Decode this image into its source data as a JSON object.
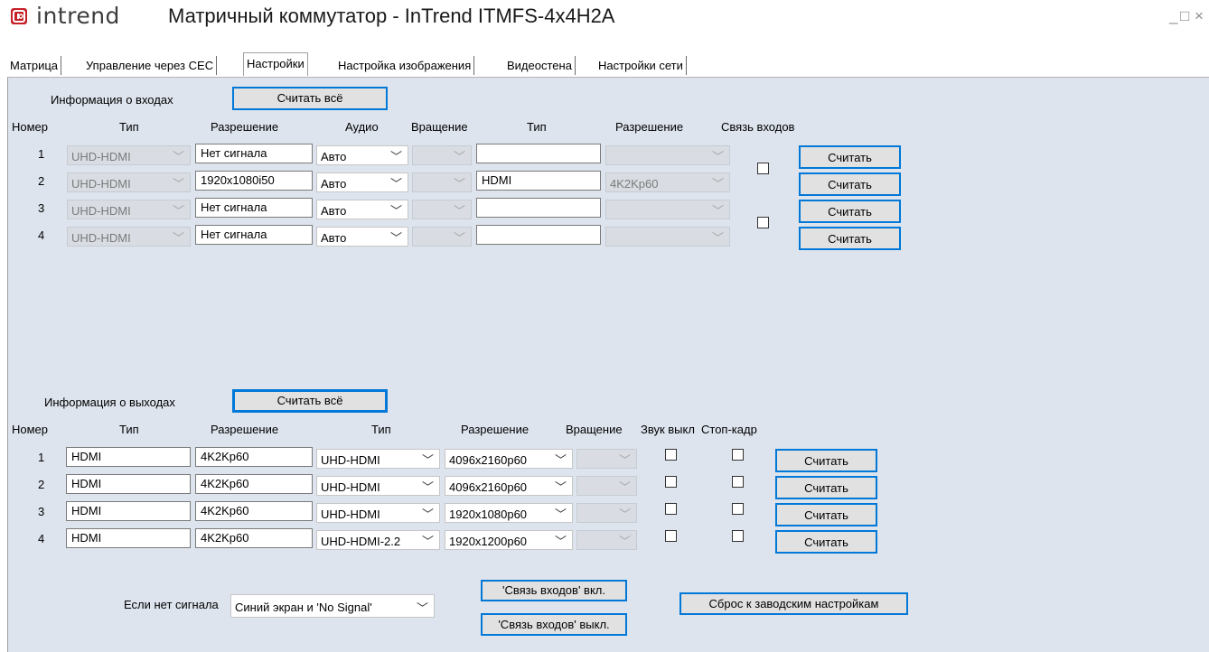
{
  "app": {
    "brand": "intrend",
    "title": "Матричный коммутатор - InTrend ITMFS-4x4H2A",
    "win_minimize": "_",
    "win_maximize": "□",
    "win_close": "×",
    "logo_icon": "intrend-logo-icon"
  },
  "tabs": [
    {
      "label": "Матрица"
    },
    {
      "label": "Управление через CEC"
    },
    {
      "label": "Настройки"
    },
    {
      "label": "Настройка изображения"
    },
    {
      "label": "Видеостена"
    },
    {
      "label": "Настройки сети"
    }
  ],
  "active_tab": "Настройки",
  "inputs": {
    "section_label": "Информация о входах",
    "read_all_label": "Считать всё",
    "headers": {
      "number": "Номер",
      "type": "Тип",
      "resolution": "Разрешение",
      "audio": "Аудио",
      "rotation": "Вращение",
      "signal_type": "Тип",
      "signal_resolution": "Разрешение",
      "link": "Связь входов"
    },
    "rows": [
      {
        "num": "1",
        "type": "UHD-HDMI",
        "resolution": "Нет сигнала",
        "audio": "Авто",
        "rotation": "",
        "signal_type": "",
        "signal_resolution": "",
        "read_label": "Считать"
      },
      {
        "num": "2",
        "type": "UHD-HDMI",
        "resolution": "1920x1080i50",
        "audio": "Авто",
        "rotation": "",
        "signal_type": "HDMI",
        "signal_resolution": "4K2Kp60",
        "read_label": "Считать"
      },
      {
        "num": "3",
        "type": "UHD-HDMI",
        "resolution": "Нет сигнала",
        "audio": "Авто",
        "rotation": "",
        "signal_type": "",
        "signal_resolution": "",
        "read_label": "Считать"
      },
      {
        "num": "4",
        "type": "UHD-HDMI",
        "resolution": "Нет сигнала",
        "audio": "Авто",
        "rotation": "",
        "signal_type": "",
        "signal_resolution": "",
        "read_label": "Считать"
      }
    ],
    "link_checkboxes": [
      false,
      false
    ]
  },
  "outputs": {
    "section_label": "Информация о выходах",
    "read_all_label": "Считать всё",
    "headers": {
      "number": "Номер",
      "type": "Тип",
      "resolution": "Разрешение",
      "out_type": "Тип",
      "out_resolution": "Разрешение",
      "rotation": "Вращение",
      "mute": "Звук выкл",
      "freeze": "Стоп-кадр"
    },
    "rows": [
      {
        "num": "1",
        "type": "HDMI",
        "resolution": "4K2Kp60",
        "out_type": "UHD-HDMI",
        "out_resolution": "4096x2160p60",
        "rotation": "",
        "mute": false,
        "freeze": false,
        "read_label": "Считать"
      },
      {
        "num": "2",
        "type": "HDMI",
        "resolution": "4K2Kp60",
        "out_type": "UHD-HDMI",
        "out_resolution": "4096x2160p60",
        "rotation": "",
        "mute": false,
        "freeze": false,
        "read_label": "Считать"
      },
      {
        "num": "3",
        "type": "HDMI",
        "resolution": "4K2Kp60",
        "out_type": "UHD-HDMI",
        "out_resolution": "1920x1080p60",
        "rotation": "",
        "mute": false,
        "freeze": false,
        "read_label": "Считать"
      },
      {
        "num": "4",
        "type": "HDMI",
        "resolution": "4K2Kp60",
        "out_type": "UHD-HDMI-2.2",
        "out_resolution": "1920x1200p60",
        "rotation": "",
        "mute": false,
        "freeze": false,
        "read_label": "Считать"
      }
    ]
  },
  "bottom": {
    "no_signal_label": "Если нет сигнала",
    "no_signal_value": "Синий экран и 'No Signal'",
    "link_on_label": "'Связь входов' вкл.",
    "link_off_label": "'Связь входов' выкл.",
    "factory_reset_label": "Сброс к заводским настройкам"
  },
  "colors": {
    "panel_bg": "#dde4ed",
    "button_border": "#0078d7",
    "logo_red": "#c62027"
  }
}
